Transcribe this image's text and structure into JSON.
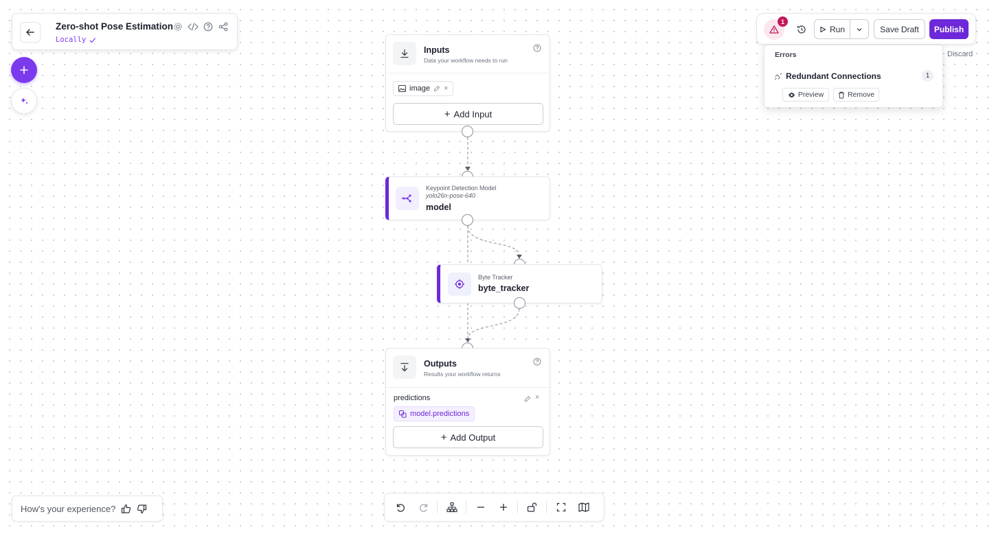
{
  "header": {
    "title": "Zero-shot Pose Estimation",
    "environment": "Locally"
  },
  "toolbar": {
    "error_badge": "1",
    "run_label": "Run",
    "save_draft_label": "Save Draft",
    "publish_label": "Publish",
    "discard_label": "Discard"
  },
  "errors": {
    "title": "Errors",
    "items": [
      {
        "label": "Redundant Connections",
        "count": "1",
        "preview_label": "Preview",
        "remove_label": "Remove"
      }
    ]
  },
  "nodes": {
    "inputs": {
      "title": "Inputs",
      "subtitle": "Data your workflow needs to run",
      "items": [
        {
          "name": "image"
        }
      ],
      "add_label": "Add Input"
    },
    "model": {
      "type_label": "Keypoint Detection Model",
      "model_id": "yolo26n-pose-640",
      "name": "model"
    },
    "tracker": {
      "type_label": "Byte Tracker",
      "name": "byte_tracker"
    },
    "outputs": {
      "title": "Outputs",
      "subtitle": "Results your workflow returns",
      "items": [
        {
          "name": "predictions",
          "selector": "model.predictions"
        }
      ],
      "add_label": "Add Output"
    }
  },
  "feedback": {
    "prompt": "How's your experience?"
  },
  "colors": {
    "accent": "#6d28d9",
    "error": "#c2185b"
  }
}
